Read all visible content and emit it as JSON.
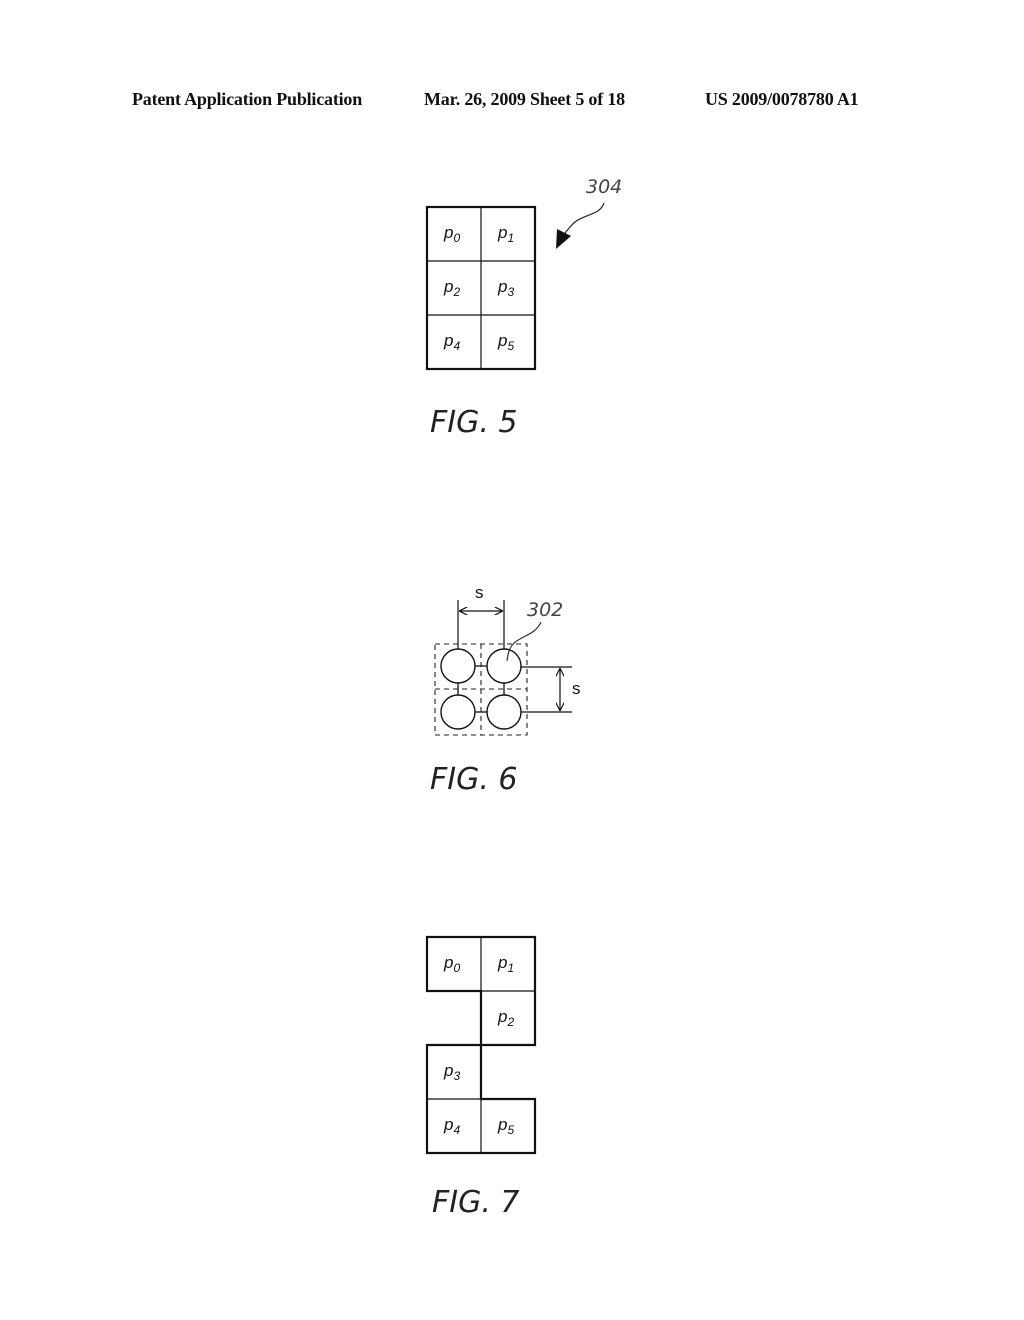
{
  "header": {
    "left": "Patent Application Publication",
    "middle": "Mar. 26, 2009  Sheet 5 of 18",
    "right": "US 2009/0078780 A1"
  },
  "figures": [
    {
      "caption": "FIG. 5",
      "reference": "304",
      "description": "2x3 grid of pixel cells",
      "cells": [
        {
          "letter": "p",
          "sub": "0"
        },
        {
          "letter": "p",
          "sub": "1"
        },
        {
          "letter": "p",
          "sub": "2"
        },
        {
          "letter": "p",
          "sub": "3"
        },
        {
          "letter": "p",
          "sub": "4"
        },
        {
          "letter": "p",
          "sub": "5"
        }
      ]
    },
    {
      "caption": "FIG. 6",
      "reference": "302",
      "description": "2x2 array of circular dots with spacing s",
      "spacing_label_horizontal": "s",
      "spacing_label_vertical": "s"
    },
    {
      "caption": "FIG. 7",
      "description": "staggered arrangement of six pixel cells",
      "cells": [
        {
          "letter": "p",
          "sub": "0"
        },
        {
          "letter": "p",
          "sub": "1"
        },
        {
          "letter": "p",
          "sub": "2"
        },
        {
          "letter": "p",
          "sub": "3"
        },
        {
          "letter": "p",
          "sub": "4"
        },
        {
          "letter": "p",
          "sub": "5"
        }
      ]
    }
  ]
}
